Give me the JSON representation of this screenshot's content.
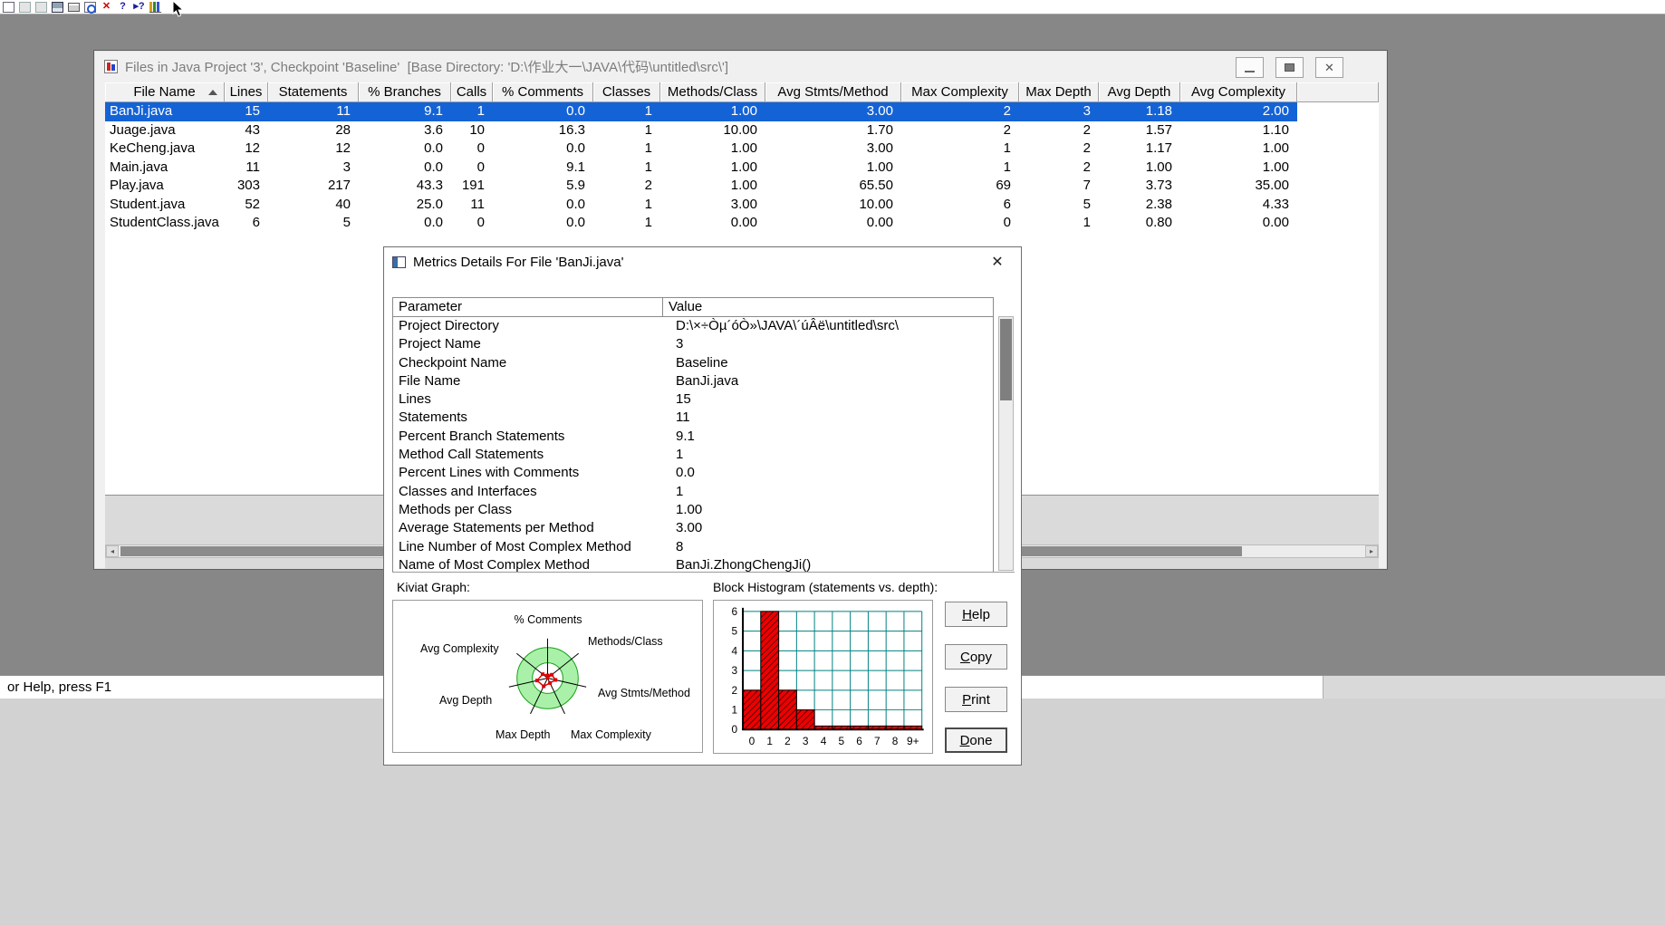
{
  "toolbar": {
    "icons": [
      {
        "name": "new-file-icon",
        "cls": "ico-page"
      },
      {
        "name": "back-icon",
        "cls": "ico-page dim"
      },
      {
        "name": "forward-icon",
        "cls": "ico-page dim"
      },
      {
        "name": "save-icon",
        "cls": "ico-floppy"
      },
      {
        "name": "print-icon",
        "cls": "ico-printer"
      },
      {
        "name": "print-preview-icon",
        "cls": "ico-preview"
      },
      {
        "name": "delete-checkpoint-icon",
        "cls": "ico-delete",
        "glyph": "✕"
      },
      {
        "name": "about-help-icon",
        "cls": "ico-help",
        "glyph": "?"
      },
      {
        "name": "context-help-icon",
        "cls": "ico-help",
        "glyph": "▸?"
      },
      {
        "name": "chart-icon",
        "cls": "ico-chart"
      }
    ]
  },
  "main_window": {
    "title": "Files in Java Project '3', Checkpoint 'Baseline'  [Base Directory: 'D:\\作业大一\\JAVA\\代码\\untitled\\src\\']",
    "columns": [
      "File Name",
      "Lines",
      "Statements",
      "% Branches",
      "Calls",
      "% Comments",
      "Classes",
      "Methods/Class",
      "Avg Stmts/Method",
      "Max Complexity",
      "Max Depth",
      "Avg Depth",
      "Avg Complexity"
    ],
    "rows": [
      {
        "selected": true,
        "cells": [
          "BanJi.java",
          "15",
          "11",
          "9.1",
          "1",
          "0.0",
          "1",
          "1.00",
          "3.00",
          "2",
          "3",
          "1.18",
          "2.00"
        ]
      },
      {
        "selected": false,
        "cells": [
          "Juage.java",
          "43",
          "28",
          "3.6",
          "10",
          "16.3",
          "1",
          "10.00",
          "1.70",
          "2",
          "2",
          "1.57",
          "1.10"
        ]
      },
      {
        "selected": false,
        "cells": [
          "KeCheng.java",
          "12",
          "12",
          "0.0",
          "0",
          "0.0",
          "1",
          "1.00",
          "3.00",
          "1",
          "2",
          "1.17",
          "1.00"
        ]
      },
      {
        "selected": false,
        "cells": [
          "Main.java",
          "11",
          "3",
          "0.0",
          "0",
          "9.1",
          "1",
          "1.00",
          "1.00",
          "1",
          "2",
          "1.00",
          "1.00"
        ]
      },
      {
        "selected": false,
        "cells": [
          "Play.java",
          "303",
          "217",
          "43.3",
          "191",
          "5.9",
          "2",
          "1.00",
          "65.50",
          "69",
          "7",
          "3.73",
          "35.00"
        ]
      },
      {
        "selected": false,
        "cells": [
          "Student.java",
          "52",
          "40",
          "25.0",
          "11",
          "0.0",
          "1",
          "3.00",
          "10.00",
          "6",
          "5",
          "2.38",
          "4.33"
        ]
      },
      {
        "selected": false,
        "cells": [
          "StudentClass.java",
          "6",
          "5",
          "0.0",
          "0",
          "0.0",
          "1",
          "0.00",
          "0.00",
          "0",
          "1",
          "0.80",
          "0.00"
        ]
      }
    ],
    "window_buttons": [
      "minimize",
      "maximize",
      "close"
    ]
  },
  "dialog": {
    "title": "Metrics Details For File 'BanJi.java'",
    "param_header": [
      "Parameter",
      "Value"
    ],
    "params": [
      [
        "Project Directory",
        "D:\\×÷Òµ´óÒ»\\JAVA\\´úÂë\\untitled\\src\\"
      ],
      [
        "Project Name",
        "3"
      ],
      [
        "Checkpoint Name",
        "Baseline"
      ],
      [
        "File Name",
        "BanJi.java"
      ],
      [
        "Lines",
        "15"
      ],
      [
        "Statements",
        "11"
      ],
      [
        "Percent Branch Statements",
        "9.1"
      ],
      [
        "Method Call Statements",
        "1"
      ],
      [
        "Percent Lines with Comments",
        "0.0"
      ],
      [
        "Classes and Interfaces",
        "1"
      ],
      [
        "Methods per Class",
        "1.00"
      ],
      [
        "Average Statements per Method",
        "3.00"
      ],
      [
        "Line Number of Most Complex Method",
        "8"
      ],
      [
        "Name of Most Complex Method",
        "BanJi.ZhongChengJi()"
      ]
    ],
    "kiviat": {
      "label": "Kiviat Graph:",
      "type": "radar",
      "axes": [
        "% Comments",
        "Methods/Class",
        "Avg Stmts/Method",
        "Max Complexity",
        "Max Depth",
        "Avg Depth",
        "Avg Complexity"
      ],
      "values": [
        "0.0",
        "1.00",
        "3.00",
        "2",
        "3",
        "1.18",
        "2.00"
      ]
    },
    "histogram": {
      "label": "Block Histogram (statements vs. depth):",
      "type": "bar",
      "x_labels": [
        "0",
        "1",
        "2",
        "3",
        "4",
        "5",
        "6",
        "7",
        "8",
        "9+"
      ],
      "y_ticks": [
        0,
        1,
        2,
        3,
        4,
        5,
        6
      ],
      "values": [
        2,
        6,
        2,
        1,
        0,
        0,
        0,
        0,
        0,
        0
      ],
      "bar_color": "#ee0000",
      "grid_color": "#008080"
    },
    "buttons": [
      {
        "label": "Help"
      },
      {
        "label": "Copy"
      },
      {
        "label": "Print"
      },
      {
        "label": "Done",
        "default": true
      }
    ]
  },
  "status_bar": {
    "text": "or Help, press F1"
  },
  "colors": {
    "selection_blue": "#1463d6",
    "histogram_red": "#ee0000",
    "grid_teal": "#008080",
    "kiviat_green": "#a9f1a9"
  }
}
